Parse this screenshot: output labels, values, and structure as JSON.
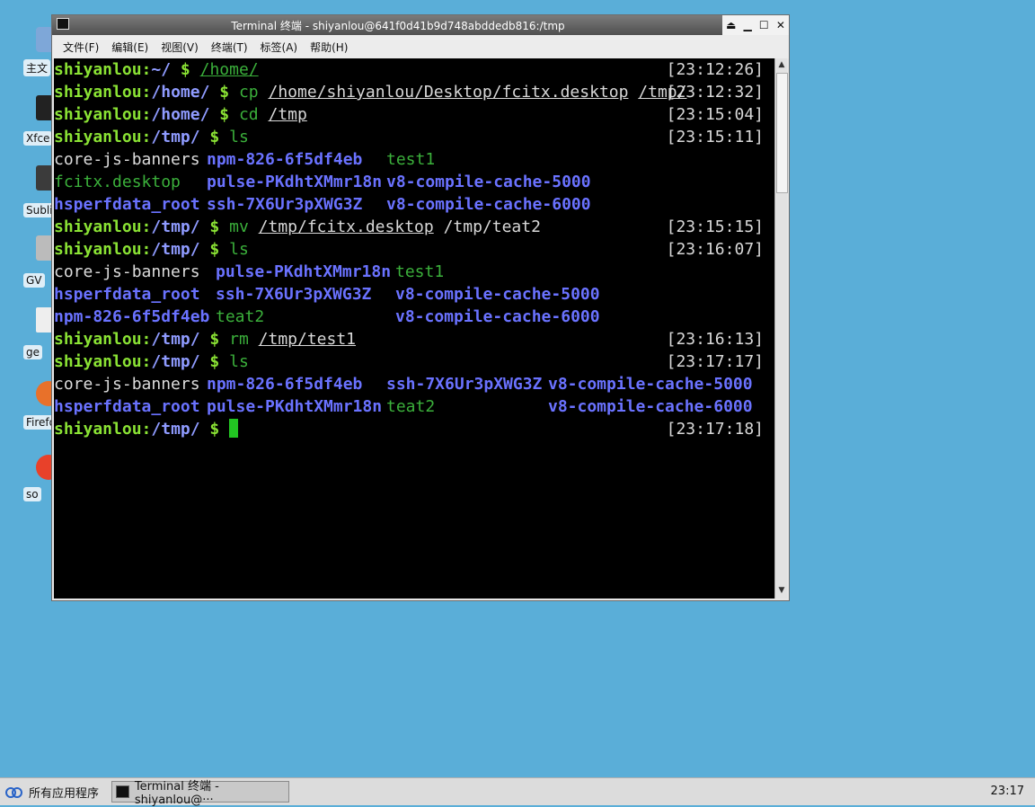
{
  "desktop": {
    "icons": [
      {
        "label": "主文",
        "icon": "home-folder-icon"
      },
      {
        "label": "Xfce",
        "icon": "terminal-icon"
      },
      {
        "label": "Subli",
        "icon": "sublime-icon"
      },
      {
        "label": "GV",
        "icon": "gvim-icon"
      },
      {
        "label": "ge",
        "icon": "text-editor-icon"
      },
      {
        "label": "Firefo",
        "icon": "firefox-icon"
      },
      {
        "label": "so",
        "icon": "sogou-icon"
      }
    ]
  },
  "window": {
    "title": "Terminal 终端 - shiyanlou@641f0d41b9d748abddedb816:/tmp",
    "menu": [
      "文件(F)",
      "编辑(E)",
      "视图(V)",
      "终端(T)",
      "标签(A)",
      "帮助(H)"
    ]
  },
  "terminal": {
    "user": "shiyanlou",
    "lines": {
      "l1": {
        "path": "~/",
        "cmd": "",
        "arg1": "/home/",
        "ts": "[23:12:26]"
      },
      "l2": {
        "path": "/home/",
        "cmd": "cp",
        "arg1": "/home/shiyanlou/Desktop/fcitx.desktop",
        "arg2": "/tmp/",
        "ts": "[23:12:32]"
      },
      "l3": {
        "path": "/home/",
        "cmd": "cd",
        "arg1": "/tmp",
        "ts": "[23:15:04]"
      },
      "l4": {
        "path": "/tmp/",
        "cmd": "ls",
        "ts": "[23:15:11]"
      },
      "ls1": [
        [
          "core-js-banners",
          "npm-826-6f5df4eb",
          "test1"
        ],
        [
          "fcitx.desktop",
          "pulse-PKdhtXMmr18n",
          "v8-compile-cache-5000"
        ],
        [
          "hsperfdata_root",
          "ssh-7X6Ur3pXWG3Z",
          "v8-compile-cache-6000"
        ]
      ],
      "l5": {
        "path": "/tmp/",
        "cmd": "mv",
        "arg1": "/tmp/fcitx.desktop",
        "arg2": "/tmp/teat2",
        "ts": "[23:15:15]"
      },
      "l6": {
        "path": "/tmp/",
        "cmd": "ls",
        "ts": "[23:16:07]"
      },
      "ls2": [
        [
          "core-js-banners",
          "pulse-PKdhtXMmr18n",
          "test1"
        ],
        [
          "hsperfdata_root",
          "ssh-7X6Ur3pXWG3Z",
          "v8-compile-cache-5000"
        ],
        [
          "npm-826-6f5df4eb",
          "teat2",
          "v8-compile-cache-6000"
        ]
      ],
      "l7": {
        "path": "/tmp/",
        "cmd": "rm",
        "arg1": "/tmp/test1",
        "ts": "[23:16:13]"
      },
      "l8": {
        "path": "/tmp/",
        "cmd": "ls",
        "ts": "[23:17:17]"
      },
      "ls3": [
        [
          "core-js-banners",
          "npm-826-6f5df4eb",
          "ssh-7X6Ur3pXWG3Z",
          "v8-compile-cache-5000"
        ],
        [
          "hsperfdata_root",
          "pulse-PKdhtXMmr18n",
          "teat2",
          "v8-compile-cache-6000"
        ]
      ],
      "l9": {
        "path": "/tmp/",
        "ts": "[23:17:18]"
      }
    }
  },
  "taskbar": {
    "apps_menu": "所有应用程序",
    "task": "Terminal 终端 - shiyanlou@···",
    "clock": "23:17"
  }
}
